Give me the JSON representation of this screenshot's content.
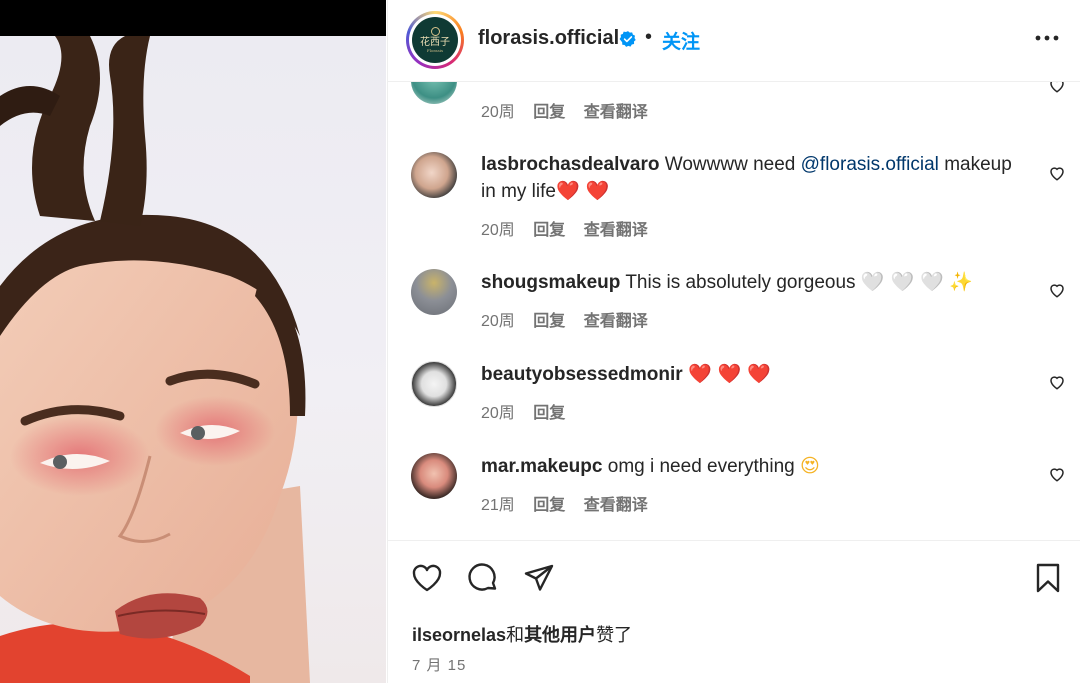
{
  "post": {
    "username": "florasis.official",
    "dot": "•",
    "follow_label": "关注",
    "avatar_logo_text": "花西子",
    "avatar_logo_sub": "Florasis"
  },
  "comments": [
    {
      "username": "",
      "text": "",
      "time": "20周",
      "reply": "回复",
      "translate": "查看翻译"
    },
    {
      "username": "lasbrochasdealvaro",
      "text_before": "Wowwww need",
      "mention": "@florasis.official",
      "text_after": "makeup in my life",
      "emojis": "❤️ ❤️",
      "time": "20周",
      "reply": "回复",
      "translate": "查看翻译"
    },
    {
      "username": "shougsmakeup",
      "text": "This is absolutely gorgeous",
      "emojis": "🤍 🤍 🤍",
      "sparkle": "✨",
      "time": "20周",
      "reply": "回复",
      "translate": "查看翻译"
    },
    {
      "username": "beautyobsessedmonir",
      "emojis": "❤️ ❤️ ❤️",
      "time": "20周",
      "reply": "回复"
    },
    {
      "username": "mar.makeupc",
      "text": "omg i need everything",
      "emojis": "😍",
      "time": "21周",
      "reply": "回复",
      "translate": "查看翻译"
    }
  ],
  "likes": {
    "user": "ilseornelas",
    "conjunction": "和",
    "others": "其他用户",
    "suffix": "赞了"
  },
  "date": "7 月 15",
  "icons": [
    "heart-icon",
    "comment-icon",
    "share-icon",
    "bookmark-icon",
    "more-icon",
    "verified-icon"
  ],
  "colors": {
    "accent": "#0095f6",
    "mention": "#00376b",
    "meta": "#737373",
    "text": "#262626"
  }
}
